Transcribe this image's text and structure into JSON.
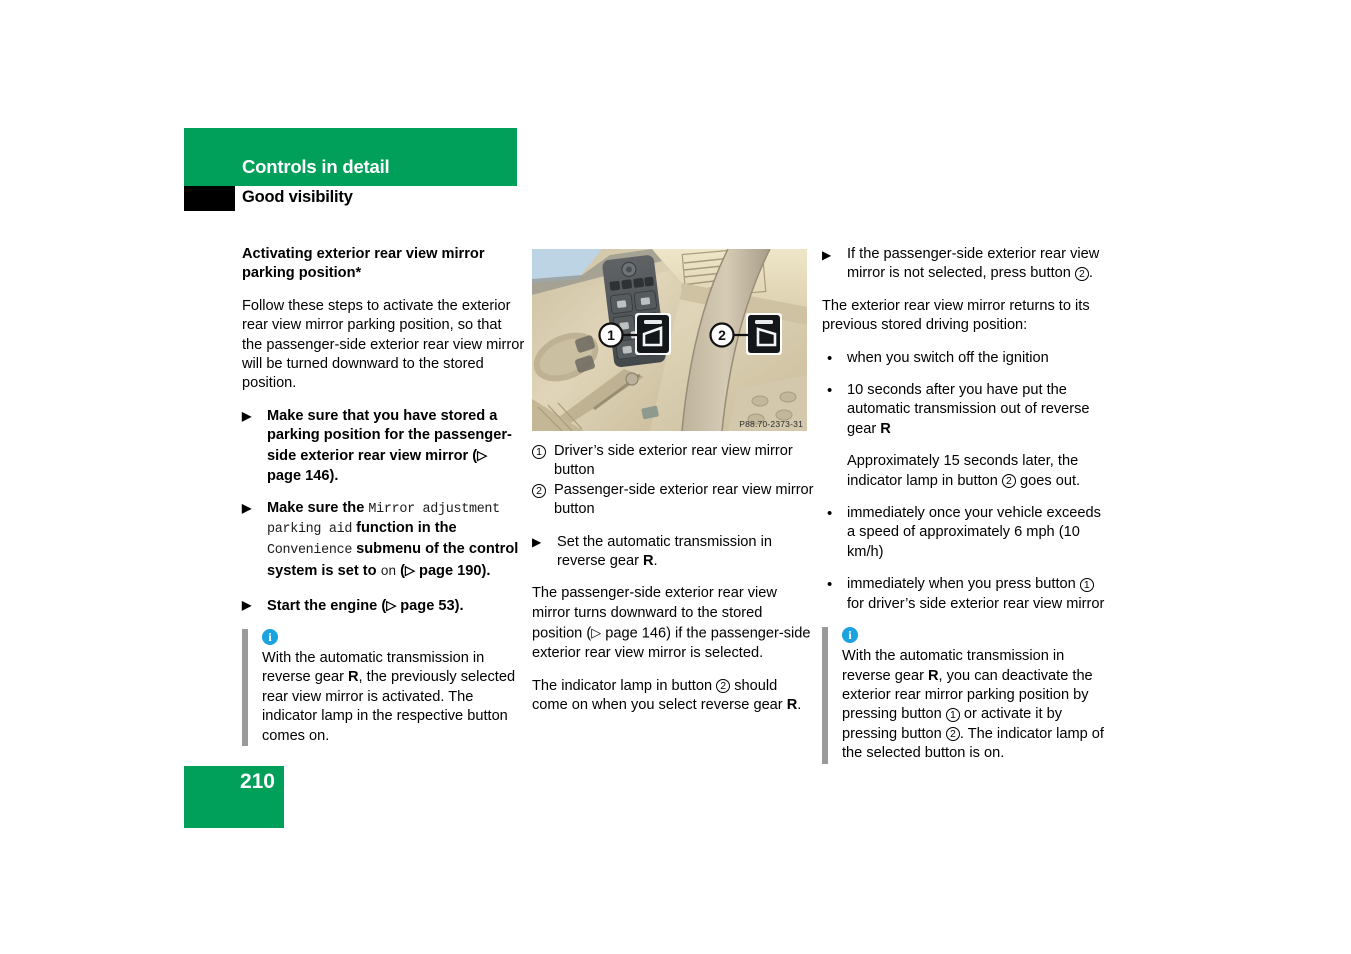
{
  "header": {
    "chapter": "Controls in detail",
    "section": "Good visibility"
  },
  "footer": {
    "page_number": "210"
  },
  "left_column": {
    "heading": "Activating exterior rear view mirror parking position*",
    "intro": "Follow these steps to activate the exterior rear view mirror parking position, so that the passenger-side exterior rear view mirror will be turned downward to the stored position.",
    "steps": [
      {
        "parts": [
          {
            "t": "Make sure that you have stored a parking position for the passenger-side exterior rear view mirror (",
            "style": "bold"
          },
          {
            "t": "▷",
            "style": "ref"
          },
          {
            "t": " page 146).",
            "style": "bold"
          }
        ]
      },
      {
        "parts": [
          {
            "t": "Make sure the ",
            "style": "bold"
          },
          {
            "t": "Mirror adjustment parking aid",
            "style": "mono"
          },
          {
            "t": " function in the ",
            "style": "bold"
          },
          {
            "t": "Convenience",
            "style": "mono"
          },
          {
            "t": " submenu of the control system is set to ",
            "style": "bold"
          },
          {
            "t": "on",
            "style": "mono"
          },
          {
            "t": " (",
            "style": "bold"
          },
          {
            "t": "▷",
            "style": "ref"
          },
          {
            "t": " page 190).",
            "style": "bold"
          }
        ]
      },
      {
        "parts": [
          {
            "t": "Start the engine (",
            "style": "bold"
          },
          {
            "t": "▷",
            "style": "ref"
          },
          {
            "t": " page 53).",
            "style": "bold"
          }
        ]
      }
    ],
    "note": {
      "icon": "info-icon",
      "parts": [
        {
          "t": "With the automatic transmission in reverse gear ",
          "style": "plain"
        },
        {
          "t": "R",
          "style": "bold"
        },
        {
          "t": ", the previously selected rear view mirror is activated. The indicator lamp in the respective button comes on.",
          "style": "plain"
        }
      ]
    }
  },
  "middle_column": {
    "figure": {
      "alt": "Driver door switch panel with two exterior mirror buttons called out",
      "code": "P88.70-2373-31",
      "callouts": [
        "1",
        "2"
      ]
    },
    "captions": [
      {
        "num": "1",
        "text": "Driver’s side exterior rear view mirror button"
      },
      {
        "num": "2",
        "text": "Passenger-side exterior rear view mirror button"
      }
    ],
    "step": {
      "parts": [
        {
          "t": "Set the automatic transmission in reverse gear ",
          "style": "plain"
        },
        {
          "t": "R",
          "style": "bold"
        },
        {
          "t": ".",
          "style": "plain"
        }
      ]
    },
    "paragraphs": [
      {
        "parts": [
          {
            "t": "The passenger-side exterior rear view mirror turns downward to the stored position (",
            "style": "plain"
          },
          {
            "t": "▷",
            "style": "ref"
          },
          {
            "t": " page 146) if the passenger-side exterior rear view mirror is selected.",
            "style": "plain"
          }
        ]
      },
      {
        "parts": [
          {
            "t": "The indicator lamp in button ",
            "style": "plain"
          },
          {
            "t": "2",
            "style": "circle"
          },
          {
            "t": " should come on when you select reverse gear ",
            "style": "plain"
          },
          {
            "t": "R",
            "style": "bold"
          },
          {
            "t": ".",
            "style": "plain"
          }
        ]
      }
    ]
  },
  "right_column": {
    "step": {
      "parts": [
        {
          "t": "If the passenger-side exterior rear view mirror is not selected, press button ",
          "style": "plain"
        },
        {
          "t": "2",
          "style": "circle"
        },
        {
          "t": ".",
          "style": "plain"
        }
      ]
    },
    "lead": "The exterior rear view mirror returns to its previous stored driving position:",
    "bullets": [
      {
        "parts": [
          {
            "t": "when you switch off the ignition",
            "style": "plain"
          }
        ]
      },
      {
        "parts": [
          {
            "t": "10 seconds after you have put the automatic transmission out of reverse gear ",
            "style": "plain"
          },
          {
            "t": "R",
            "style": "bold"
          }
        ],
        "sub": {
          "parts": [
            {
              "t": "Approximately 15 seconds later, the indicator lamp in button ",
              "style": "plain"
            },
            {
              "t": "2",
              "style": "circle"
            },
            {
              "t": " goes out.",
              "style": "plain"
            }
          ]
        }
      },
      {
        "parts": [
          {
            "t": "immediately once your vehicle exceeds a speed of approximately 6 mph (10 km/h)",
            "style": "plain"
          }
        ]
      },
      {
        "parts": [
          {
            "t": "immediately when you press button ",
            "style": "plain"
          },
          {
            "t": "1",
            "style": "circle"
          },
          {
            "t": " for driver’s side exterior rear view mirror",
            "style": "plain"
          }
        ]
      }
    ],
    "note": {
      "icon": "info-icon",
      "parts": [
        {
          "t": "With the automatic transmission in reverse gear ",
          "style": "plain"
        },
        {
          "t": "R",
          "style": "bold"
        },
        {
          "t": ", you can deactivate the exterior rear mirror parking position by pressing button ",
          "style": "plain"
        },
        {
          "t": "1",
          "style": "circle"
        },
        {
          "t": " or activate it by pressing button ",
          "style": "plain"
        },
        {
          "t": "2",
          "style": "circle"
        },
        {
          "t": ". The indicator lamp of the selected button is on.",
          "style": "plain"
        }
      ]
    }
  },
  "colors": {
    "brand_green": "#00a05a",
    "info_blue": "#1ba3e0",
    "note_rule": "#9a9a9a"
  }
}
